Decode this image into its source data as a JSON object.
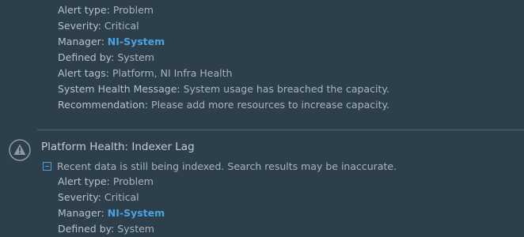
{
  "alerts": [
    {
      "fields": {
        "alert_type_label": "Alert type:",
        "alert_type_value": "Problem",
        "severity_label": "Severity:",
        "severity_value": "Critical",
        "manager_label": "Manager:",
        "manager_value": "NI-System",
        "defined_by_label": "Defined by:",
        "defined_by_value": "System",
        "alert_tags_label": "Alert tags:",
        "alert_tags_value": "Platform, NI Infra Health",
        "health_message_label": "System Health Message:",
        "health_message_value": "System usage has breached the capacity.",
        "recommendation_label": "Recommendation:",
        "recommendation_value": "Please add more resources to increase capacity."
      }
    },
    {
      "title": "Platform Health: Indexer Lag",
      "icon": "warning-triangle-icon",
      "summary": "Recent data is still being indexed. Search results may be inaccurate.",
      "fields": {
        "alert_type_label": "Alert type:",
        "alert_type_value": "Problem",
        "severity_label": "Severity:",
        "severity_value": "Critical",
        "manager_label": "Manager:",
        "manager_value": "NI-System",
        "defined_by_label": "Defined by:",
        "defined_by_value": "System"
      }
    }
  ],
  "colors": {
    "background": "#2e3f4c",
    "text": "#a9b4bc",
    "link": "#4aa3e0",
    "divider": "#55646f"
  }
}
